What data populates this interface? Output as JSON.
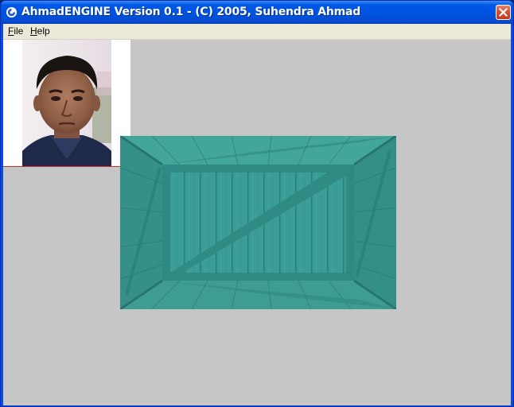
{
  "window": {
    "title": "AhmadENGINE Version 0.1 - (C) 2005, Suhendra Ahmad",
    "app_icon": "app-icon",
    "close_icon": "close-icon"
  },
  "menu": {
    "items": [
      {
        "label": "File",
        "accel": "F",
        "rest": "ile"
      },
      {
        "label": "Help",
        "accel": "H",
        "rest": "elp"
      }
    ]
  },
  "canvas": {
    "background": "#c6c6c6",
    "photo": {
      "description_icon": "portrait-image"
    },
    "crate": {
      "texture_color": "#3a9e96",
      "icon": "wooden-crate-texture"
    }
  },
  "colors": {
    "titlebar": "#0054e3",
    "close_button": "#d9502f",
    "menubar": "#ece9d8"
  }
}
